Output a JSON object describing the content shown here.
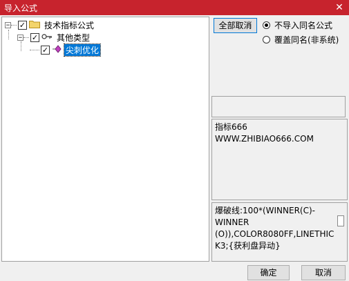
{
  "window": {
    "title": "导入公式",
    "close_glyph": "✕"
  },
  "tree": {
    "root": {
      "expander": "−",
      "checked": "✓",
      "label": "技术指标公式"
    },
    "child": {
      "expander": "−",
      "checked": "✓",
      "label": "其他类型"
    },
    "leaf": {
      "checked": "✓",
      "label": "尖刺优化"
    }
  },
  "buttons": {
    "uncheck_all": "全部取消",
    "ok": "确定",
    "cancel": "取消"
  },
  "options": [
    {
      "label": "不导入同名公式",
      "selected": true
    },
    {
      "label": "覆盖同名(非系统)",
      "selected": false
    }
  ],
  "info_text": "指标666\nWWW.ZHIBIAO666.COM",
  "formula_text": "爆破线:100*(WINNER(C)-\nWINNER\n(O)),COLOR8080FF,LINETHIC\nK3;{获利盘异动}"
}
